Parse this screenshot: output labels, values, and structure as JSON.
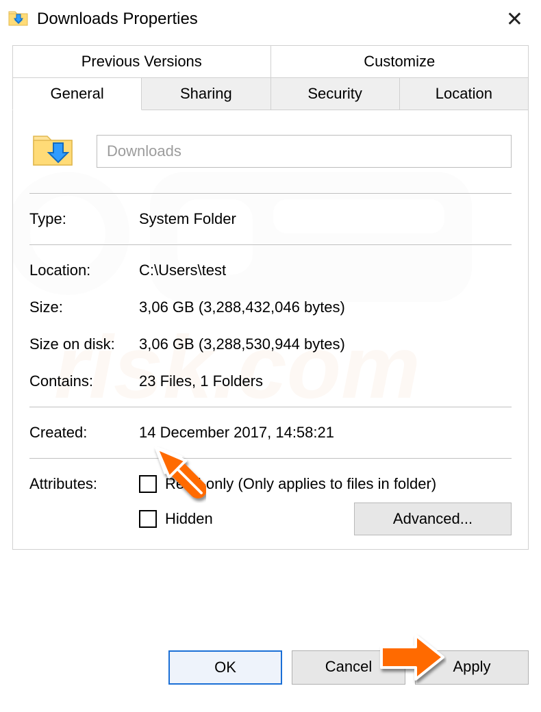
{
  "title": "Downloads Properties",
  "folderName": "Downloads",
  "tabs": {
    "row1": {
      "prev": "Previous Versions",
      "custom": "Customize"
    },
    "row2": {
      "general": "General",
      "sharing": "Sharing",
      "security": "Security",
      "location": "Location"
    }
  },
  "info": {
    "type_label": "Type:",
    "type_value": "System Folder",
    "location_label": "Location:",
    "location_value": "C:\\Users\\test",
    "size_label": "Size:",
    "size_value": "3,06 GB (3,288,432,046 bytes)",
    "sod_label": "Size on disk:",
    "sod_value": "3,06 GB (3,288,530,944 bytes)",
    "contains_label": "Contains:",
    "contains_value": "23 Files, 1 Folders",
    "created_label": "Created:",
    "created_value": "14 December 2017, 14:58:21"
  },
  "attributes": {
    "label": "Attributes:",
    "readonly": "Read-only (Only applies to files in folder)",
    "hidden": "Hidden",
    "advanced": "Advanced..."
  },
  "footer": {
    "ok": "OK",
    "cancel": "Cancel",
    "apply": "Apply"
  }
}
